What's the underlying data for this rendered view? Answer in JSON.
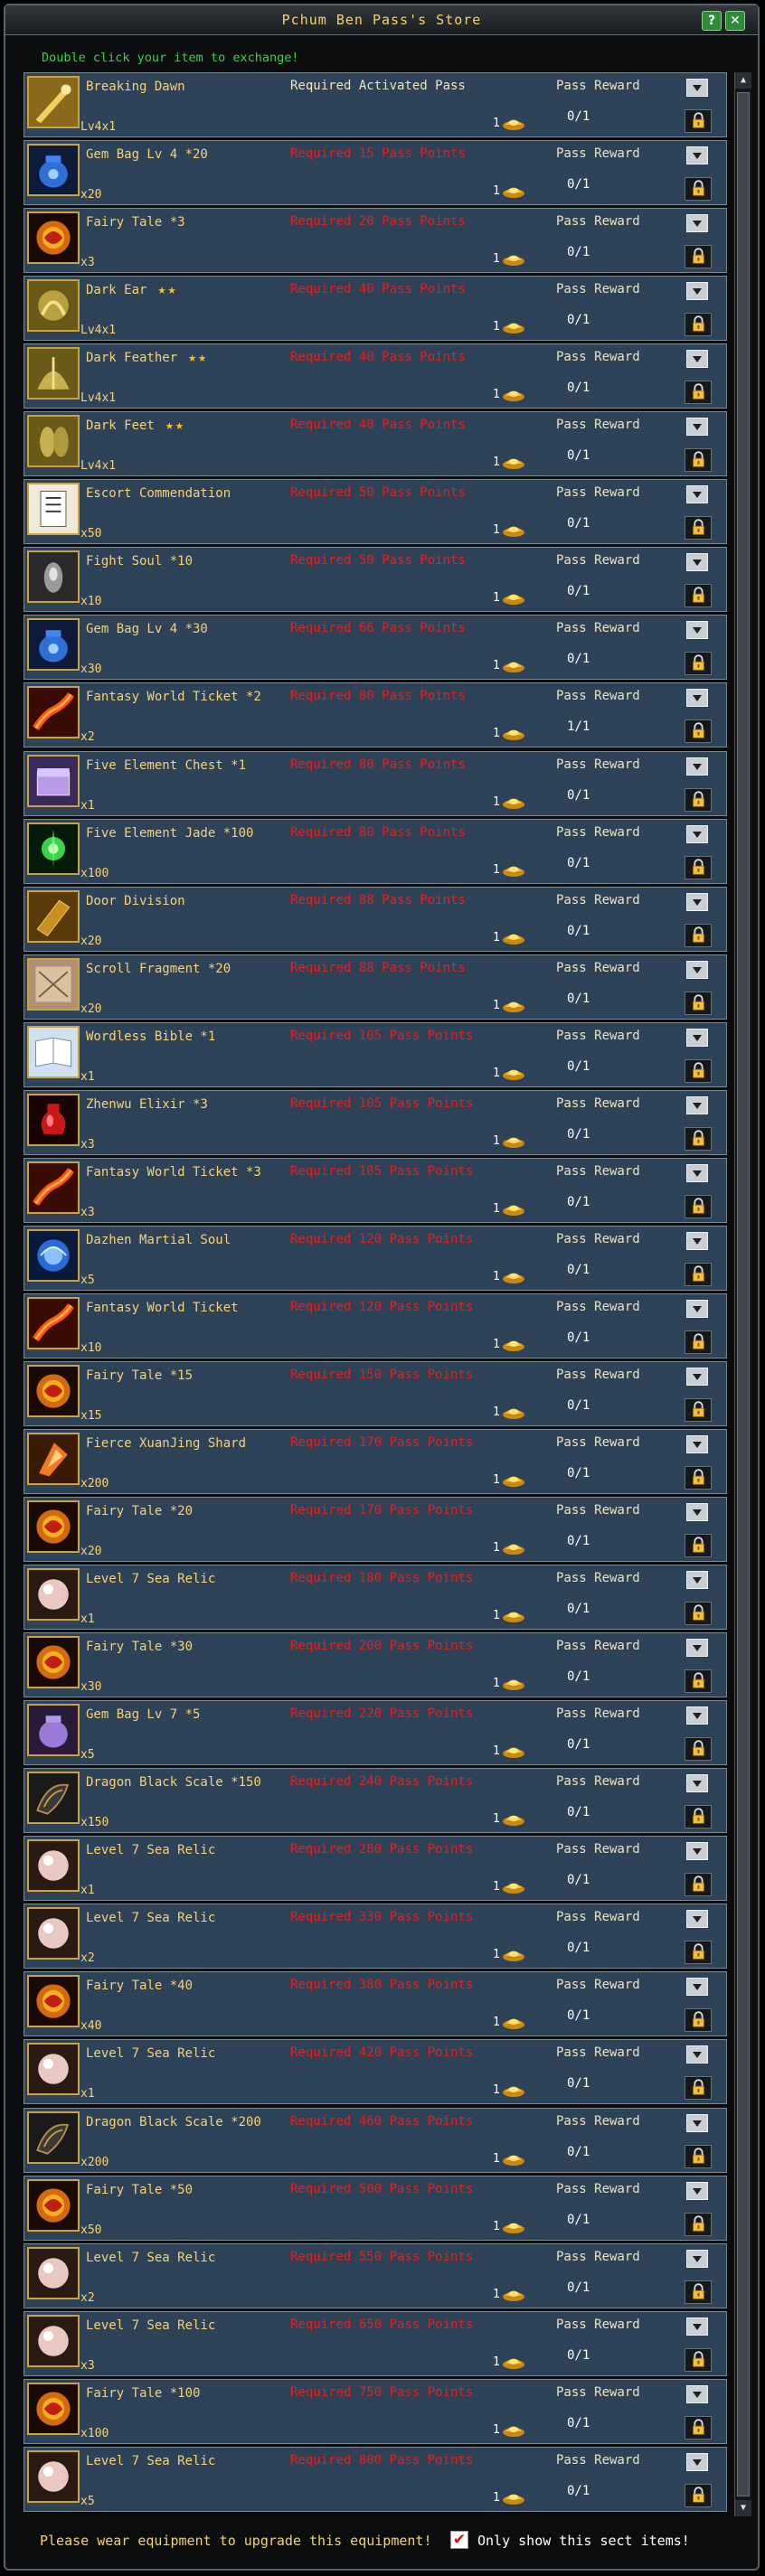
{
  "window": {
    "title": "Pchum Ben Pass's Store",
    "hint": "Double click your item to exchange!"
  },
  "footer": {
    "warning": "Please wear equipment to upgrade this equipment!",
    "filter_label": "Only show this sect items!",
    "filter_checked": true,
    "check_glyph": "✔"
  },
  "columns": {
    "reward_label": "Pass Reward"
  },
  "icons": {
    "coin": "gold-ingot-icon",
    "lock": "lock-icon",
    "dropdown": "chevron-down-icon"
  },
  "colors": {
    "row_bg": "#2e4358",
    "requirement_unmet": "#e22020",
    "name": "#f4d27a",
    "hint": "#3ad24a"
  },
  "items": [
    {
      "name": "Breaking Dawn",
      "stars": "",
      "qty": "Lv4x1",
      "requirement": "Required Activated Pass",
      "req_met": true,
      "cost": "1",
      "progress": "0/1",
      "icon": "weapon-icon"
    },
    {
      "name": "Gem Bag Lv 4 *20",
      "stars": "",
      "qty": "x20",
      "requirement": "Required 15 Pass Points",
      "req_met": false,
      "cost": "1",
      "progress": "0/1",
      "icon": "gem-bag-icon"
    },
    {
      "name": "Fairy Tale *3",
      "stars": "",
      "qty": "x3",
      "requirement": "Required 20 Pass Points",
      "req_met": false,
      "cost": "1",
      "progress": "0/1",
      "icon": "fairy-tale-icon"
    },
    {
      "name": "Dark Ear",
      "stars": "★★",
      "qty": "Lv4x1",
      "requirement": "Required 40 Pass Points",
      "req_met": false,
      "cost": "1",
      "progress": "0/1",
      "icon": "dark-ear-icon"
    },
    {
      "name": "Dark Feather",
      "stars": "★★",
      "qty": "Lv4x1",
      "requirement": "Required 40 Pass Points",
      "req_met": false,
      "cost": "1",
      "progress": "0/1",
      "icon": "dark-feather-icon"
    },
    {
      "name": "Dark Feet",
      "stars": "★★",
      "qty": "Lv4x1",
      "requirement": "Required 40 Pass Points",
      "req_met": false,
      "cost": "1",
      "progress": "0/1",
      "icon": "dark-feet-icon"
    },
    {
      "name": "Escort Commendation",
      "stars": "",
      "qty": "x50",
      "requirement": "Required 50 Pass Points",
      "req_met": false,
      "cost": "1",
      "progress": "0/1",
      "icon": "scroll-icon"
    },
    {
      "name": "Fight Soul *10",
      "stars": "",
      "qty": "x10",
      "requirement": "Required 50 Pass Points",
      "req_met": false,
      "cost": "1",
      "progress": "0/1",
      "icon": "fight-soul-icon"
    },
    {
      "name": "Gem Bag Lv 4 *30",
      "stars": "",
      "qty": "x30",
      "requirement": "Required 66 Pass Points",
      "req_met": false,
      "cost": "1",
      "progress": "0/1",
      "icon": "gem-bag-icon"
    },
    {
      "name": "Fantasy World Ticket *2",
      "stars": "",
      "qty": "x2",
      "requirement": "Required 80 Pass Points",
      "req_met": false,
      "cost": "1",
      "progress": "1/1",
      "icon": "ticket-icon"
    },
    {
      "name": "Five Element Chest *1",
      "stars": "",
      "qty": "x1",
      "requirement": "Required 80 Pass Points",
      "req_met": false,
      "cost": "1",
      "progress": "0/1",
      "icon": "chest-icon"
    },
    {
      "name": "Five Element Jade *100",
      "stars": "",
      "qty": "x100",
      "requirement": "Required 80 Pass Points",
      "req_met": false,
      "cost": "1",
      "progress": "0/1",
      "icon": "jade-icon"
    },
    {
      "name": "Door Division",
      "stars": "",
      "qty": "x20",
      "requirement": "Required 88 Pass Points",
      "req_met": false,
      "cost": "1",
      "progress": "0/1",
      "icon": "book-icon"
    },
    {
      "name": "Scroll Fragment *20",
      "stars": "",
      "qty": "x20",
      "requirement": "Required 88 Pass Points",
      "req_met": false,
      "cost": "1",
      "progress": "0/1",
      "icon": "fragment-icon"
    },
    {
      "name": "Wordless Bible *1",
      "stars": "",
      "qty": "x1",
      "requirement": "Required 105 Pass Points",
      "req_met": false,
      "cost": "1",
      "progress": "0/1",
      "icon": "bible-icon"
    },
    {
      "name": "Zhenwu Elixir *3",
      "stars": "",
      "qty": "x3",
      "requirement": "Required 105 Pass Points",
      "req_met": false,
      "cost": "1",
      "progress": "0/1",
      "icon": "elixir-icon"
    },
    {
      "name": "Fantasy World Ticket *3",
      "stars": "",
      "qty": "x3",
      "requirement": "Required 105 Pass Points",
      "req_met": false,
      "cost": "1",
      "progress": "0/1",
      "icon": "ticket-icon"
    },
    {
      "name": "Dazhen Martial Soul",
      "stars": "",
      "qty": "x5",
      "requirement": "Required 120 Pass Points",
      "req_met": false,
      "cost": "1",
      "progress": "0/1",
      "icon": "martial-soul-icon"
    },
    {
      "name": "Fantasy World Ticket",
      "stars": "",
      "qty": "x10",
      "requirement": "Required 120 Pass Points",
      "req_met": false,
      "cost": "1",
      "progress": "0/1",
      "icon": "ticket-icon"
    },
    {
      "name": "Fairy Tale *15",
      "stars": "",
      "qty": "x15",
      "requirement": "Required 150 Pass Points",
      "req_met": false,
      "cost": "1",
      "progress": "0/1",
      "icon": "fairy-tale-icon"
    },
    {
      "name": "Fierce XuanJing Shard",
      "stars": "",
      "qty": "x200",
      "requirement": "Required 170 Pass Points",
      "req_met": false,
      "cost": "1",
      "progress": "0/1",
      "icon": "shard-icon"
    },
    {
      "name": "Fairy Tale *20",
      "stars": "",
      "qty": "x20",
      "requirement": "Required 170 Pass Points",
      "req_met": false,
      "cost": "1",
      "progress": "0/1",
      "icon": "fairy-tale-icon"
    },
    {
      "name": "Level 7 Sea Relic",
      "stars": "",
      "qty": "x1",
      "requirement": "Required 180 Pass Points",
      "req_met": false,
      "cost": "1",
      "progress": "0/1",
      "icon": "pearl-icon"
    },
    {
      "name": "Fairy Tale *30",
      "stars": "",
      "qty": "x30",
      "requirement": "Required 200 Pass Points",
      "req_met": false,
      "cost": "1",
      "progress": "0/1",
      "icon": "fairy-tale-icon"
    },
    {
      "name": "Gem Bag Lv 7 *5",
      "stars": "",
      "qty": "x5",
      "requirement": "Required 220 Pass Points",
      "req_met": false,
      "cost": "1",
      "progress": "0/1",
      "icon": "gem-bag-purple-icon"
    },
    {
      "name": "Dragon Black Scale *150",
      "stars": "",
      "qty": "x150",
      "requirement": "Required 240 Pass Points",
      "req_met": false,
      "cost": "1",
      "progress": "0/1",
      "icon": "dragon-scale-icon"
    },
    {
      "name": "Level 7 Sea Relic",
      "stars": "",
      "qty": "x1",
      "requirement": "Required 280 Pass Points",
      "req_met": false,
      "cost": "1",
      "progress": "0/1",
      "icon": "pearl-icon"
    },
    {
      "name": "Level 7 Sea Relic",
      "stars": "",
      "qty": "x2",
      "requirement": "Required 330 Pass Points",
      "req_met": false,
      "cost": "1",
      "progress": "0/1",
      "icon": "pearl-icon"
    },
    {
      "name": "Fairy Tale *40",
      "stars": "",
      "qty": "x40",
      "requirement": "Required 380 Pass Points",
      "req_met": false,
      "cost": "1",
      "progress": "0/1",
      "icon": "fairy-tale-icon"
    },
    {
      "name": "Level 7 Sea Relic",
      "stars": "",
      "qty": "x1",
      "requirement": "Required 420 Pass Points",
      "req_met": false,
      "cost": "1",
      "progress": "0/1",
      "icon": "pearl-icon"
    },
    {
      "name": "Dragon Black Scale *200",
      "stars": "",
      "qty": "x200",
      "requirement": "Required 460 Pass Points",
      "req_met": false,
      "cost": "1",
      "progress": "0/1",
      "icon": "dragon-scale-icon"
    },
    {
      "name": "Fairy Tale *50",
      "stars": "",
      "qty": "x50",
      "requirement": "Required 500 Pass Points",
      "req_met": false,
      "cost": "1",
      "progress": "0/1",
      "icon": "fairy-tale-icon"
    },
    {
      "name": "Level 7 Sea Relic",
      "stars": "",
      "qty": "x2",
      "requirement": "Required 550 Pass Points",
      "req_met": false,
      "cost": "1",
      "progress": "0/1",
      "icon": "pearl-icon"
    },
    {
      "name": "Level 7 Sea Relic",
      "stars": "",
      "qty": "x3",
      "requirement": "Required 650 Pass Points",
      "req_met": false,
      "cost": "1",
      "progress": "0/1",
      "icon": "pearl-icon"
    },
    {
      "name": "Fairy Tale *100",
      "stars": "",
      "qty": "x100",
      "requirement": "Required 750 Pass Points",
      "req_met": false,
      "cost": "1",
      "progress": "0/1",
      "icon": "fairy-tale-icon"
    },
    {
      "name": "Level 7 Sea Relic",
      "stars": "",
      "qty": "x5",
      "requirement": "Required 800 Pass Points",
      "req_met": false,
      "cost": "1",
      "progress": "0/1",
      "icon": "pearl-icon"
    }
  ]
}
